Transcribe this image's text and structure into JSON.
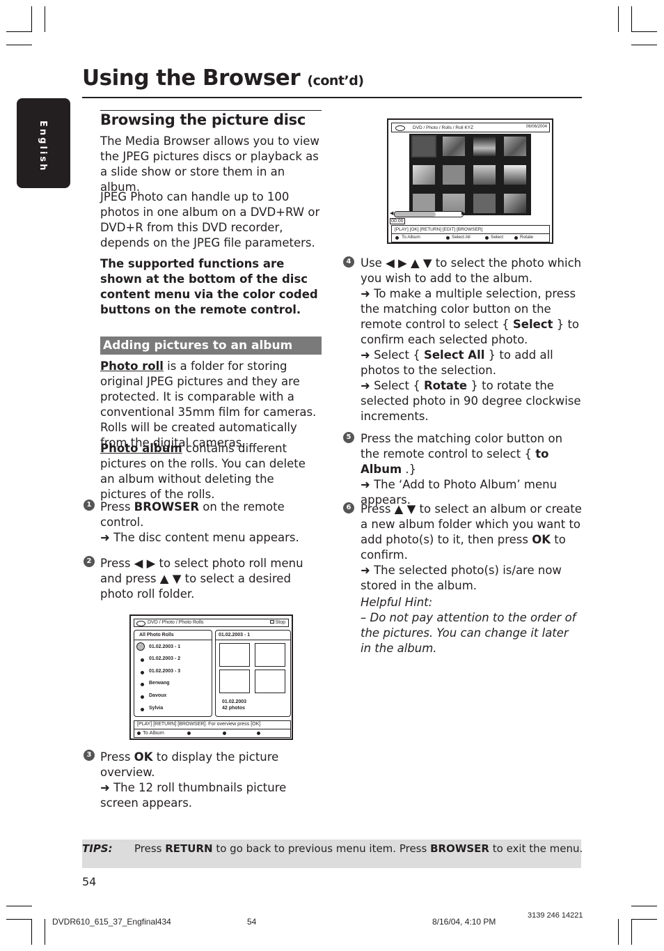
{
  "header": {
    "title": "Using the Browser",
    "title_suffix": "(cont’d)",
    "language_tab": "English"
  },
  "left_column": {
    "section_title": "Browsing the picture disc",
    "intro": "The Media Browser allows you to view the JPEG pictures discs or playback as a slide show or store them in an album.",
    "capacity": "JPEG Photo can handle up to 100 photos in one album on a DVD+RW or DVD+R from this DVD recorder, depends on the JPEG file parameters.",
    "supported_note": "The supported functions are shown at the bottom of the disc content menu via the color coded buttons on the remote control.",
    "subsection_title": "Adding pictures to an album",
    "photo_roll_term": "Photo roll",
    "photo_roll_desc": " is a folder for storing original JPEG pictures and they are protected.  It is comparable with a conventional 35mm film for cameras. Rolls will be created automatically from the digital cameras.",
    "photo_album_term": "Photo album",
    "photo_album_desc": " contains different pictures on the rolls. You can delete an album without deleting the pictures of the rolls."
  },
  "steps": [
    {
      "num": "1",
      "pre": "Press ",
      "key": "BROWSER",
      "post": " on the remote control.",
      "result": "➜ The disc content menu appears."
    },
    {
      "num": "2",
      "text": "Press ◀ ▶ to select photo roll menu and press ▲ ▼ to select a desired photo roll folder."
    },
    {
      "num": "3",
      "pre": "Press ",
      "key": "OK",
      "post": " to display the picture overview.",
      "result": "➜ The 12 roll thumbnails picture screen appears."
    },
    {
      "num": "4",
      "text": "Use ◀ ▶ ▲ ▼  to select the photo which you wish to add to the album.",
      "r1_pre": "➜ To make a multiple selection, press the matching color button on the remote control to select { ",
      "r1_key": "Select",
      "r1_post": " } to confirm each selected photo.",
      "r2_pre": "➜ Select { ",
      "r2_key": "Select All",
      "r2_post": " } to add all photos to the selection.",
      "r3_pre": "➜ Select { ",
      "r3_key": "Rotate",
      "r3_post": " } to rotate the selected photo in 90 degree clockwise increments."
    },
    {
      "num": "5",
      "pre": "Press the matching color button on the remote control to select { ",
      "key": "to Album",
      "post": " .}",
      "result": "➜ The ‘Add to Photo Album’ menu appears."
    },
    {
      "num": "6",
      "pre": "Press ▲ ▼  to select an album or create a new album folder which you want to add photo(s) to it, then press ",
      "key": "OK",
      "post": " to confirm.",
      "result": "➜ The selected photo(s) is/are now stored in the album."
    }
  ],
  "hint": {
    "label": "Helpful Hint:",
    "text": "–  Do not pay attention to the order of the pictures. You can change it later in the album."
  },
  "screen_rolls": {
    "path": "DVD / Photo / Photo Rolls",
    "stop": "Stop",
    "list_title": "All Photo Rolls",
    "items": [
      "01.02.2003 - 1",
      "01.02.2003 - 2",
      "01.02.2003 - 3",
      "Berwang",
      "Davoux",
      "Sylvia"
    ],
    "preview_title": "01.02.2003 - 1",
    "preview_date": "01.02.2003",
    "preview_count": "42 photos",
    "hint_bar": "[PLAY] [RETURN] [BROWSER].  For overview press [OK]",
    "color_buttons": [
      "To Album",
      "",
      "",
      ""
    ]
  },
  "screen_thumbs": {
    "path": "DVD / Photo / Rolls / Roll KYZ",
    "date": "06/06/2004",
    "time": "00:00",
    "hint_bar": "[PLAY] [OK] [RETURN] [EDIT] [BROWSER]",
    "color_buttons": [
      "To Album",
      "Select All",
      "Select",
      "Rotate"
    ],
    "thumbnail_count": 12
  },
  "tips": {
    "label": "TIPS:",
    "pre": "Press ",
    "k1": "RETURN",
    "mid": " to go back to previous menu item.  Press ",
    "k2": "BROWSER",
    "post": " to exit the menu."
  },
  "page_number": "54",
  "footer": {
    "file": "DVDR610_615_37_Engfinal434",
    "page": "54",
    "datetime": "8/16/04, 4:10 PM",
    "code": "3139 246 14221"
  }
}
